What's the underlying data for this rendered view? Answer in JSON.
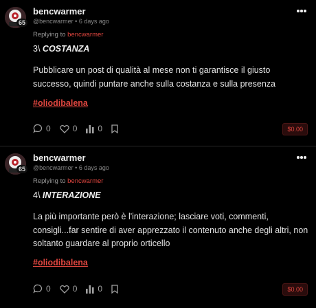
{
  "posts": [
    {
      "author": "bencwarmer",
      "handle": "@bencwarmer",
      "time": "6 days ago",
      "level": "65",
      "replying_label": "Replying to",
      "replying_to": "bencwarmer",
      "heading_prefix": "3\\",
      "heading_title": "COSTANZA",
      "body": "Pubblicare un post di qualità al mese non ti garantisce il giusto successo, quindi puntare anche sulla costanza e sulla presenza",
      "hashtag": "#oliodibalena",
      "comments": "0",
      "likes": "0",
      "views": "0",
      "price": "$0.00"
    },
    {
      "author": "bencwarmer",
      "handle": "@bencwarmer",
      "time": "6 days ago",
      "level": "65",
      "replying_label": "Replying to",
      "replying_to": "bencwarmer",
      "heading_prefix": "4\\",
      "heading_title": "INTERAZIONE",
      "body": "La più importante però è l'interazione; lasciare voti, commenti, consigli...far sentire di aver apprezzato il contenuto anche degli altri, non soltanto guardare al proprio orticello",
      "hashtag": "#oliodibalena",
      "comments": "0",
      "likes": "0",
      "views": "0",
      "price": "$0.00"
    }
  ],
  "icons": {
    "comment": "comment-icon",
    "like": "heart-icon",
    "views": "bar-chart-icon",
    "bookmark": "bookmark-icon",
    "more": "more-horizontal-icon"
  },
  "colors": {
    "background": "#000000",
    "accent": "#e0463f",
    "muted": "#888888"
  }
}
